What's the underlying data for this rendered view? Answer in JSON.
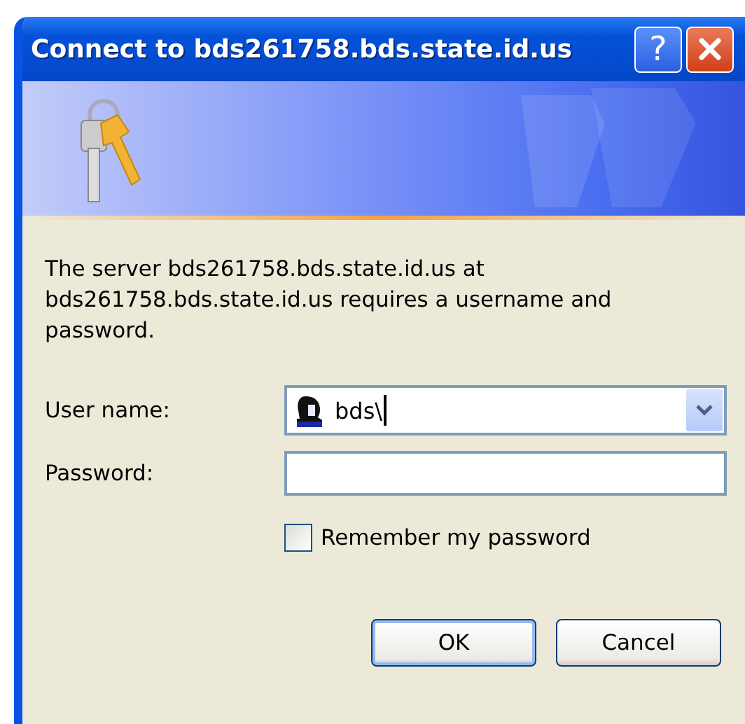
{
  "window": {
    "title": "Connect to bds261758.bds.state.id.us",
    "help_label": "?"
  },
  "message": "The server bds261758.bds.state.id.us at bds261758.bds.state.id.us requires a username and password.",
  "fields": [
    {
      "kind": "combo",
      "label": "User name:",
      "value": "bds\\"
    },
    {
      "kind": "text",
      "label": "Password:"
    }
  ],
  "remember": {
    "label": "Remember my password",
    "checked": false
  },
  "buttons": [
    {
      "label": "OK",
      "default": true
    },
    {
      "label": "Cancel",
      "default": false
    }
  ]
}
